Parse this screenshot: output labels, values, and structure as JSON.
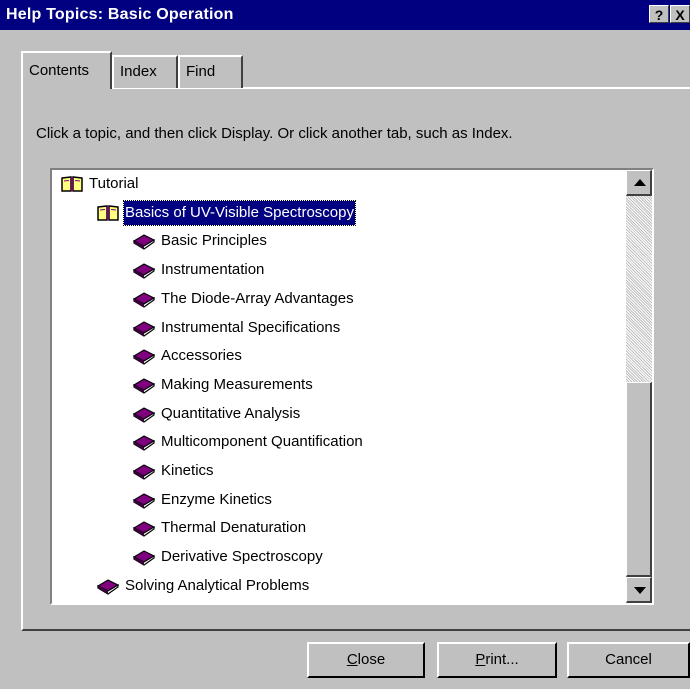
{
  "window": {
    "title": "Help Topics: Basic Operation",
    "help_button": "?",
    "close_button": "X"
  },
  "tabs": [
    {
      "label": "Contents",
      "active": true
    },
    {
      "label": "Index",
      "active": false
    },
    {
      "label": "Find",
      "active": false
    }
  ],
  "instruction": "Click a topic, and then click Display. Or click another tab, such as Index.",
  "tree": {
    "items": [
      {
        "label": "Tutorial",
        "icon": "open-book-icon",
        "level": 0
      },
      {
        "label": "Basics of UV-Visible Spectroscopy",
        "icon": "open-book-icon",
        "level": 1,
        "selected": true
      },
      {
        "label": "Basic Principles",
        "icon": "closed-book-icon",
        "level": 2
      },
      {
        "label": "Instrumentation",
        "icon": "closed-book-icon",
        "level": 2
      },
      {
        "label": "The Diode-Array Advantages",
        "icon": "closed-book-icon",
        "level": 2
      },
      {
        "label": "Instrumental Specifications",
        "icon": "closed-book-icon",
        "level": 2
      },
      {
        "label": "Accessories",
        "icon": "closed-book-icon",
        "level": 2
      },
      {
        "label": "Making Measurements",
        "icon": "closed-book-icon",
        "level": 2
      },
      {
        "label": "Quantitative Analysis",
        "icon": "closed-book-icon",
        "level": 2
      },
      {
        "label": "Multicomponent Quantification",
        "icon": "closed-book-icon",
        "level": 2
      },
      {
        "label": "Kinetics",
        "icon": "closed-book-icon",
        "level": 2
      },
      {
        "label": "Enzyme Kinetics",
        "icon": "closed-book-icon",
        "level": 2
      },
      {
        "label": "Thermal Denaturation",
        "icon": "closed-book-icon",
        "level": 2
      },
      {
        "label": "Derivative Spectroscopy",
        "icon": "closed-book-icon",
        "level": 2
      },
      {
        "label": "Solving Analytical Problems",
        "icon": "closed-book-icon",
        "level": 1
      }
    ]
  },
  "buttons": {
    "close": "Close",
    "print": "Print...",
    "cancel": "Cancel"
  },
  "colors": {
    "title_bar": "#000080",
    "face": "#c0c0c0",
    "selection": "#000080",
    "book": "#800080"
  }
}
